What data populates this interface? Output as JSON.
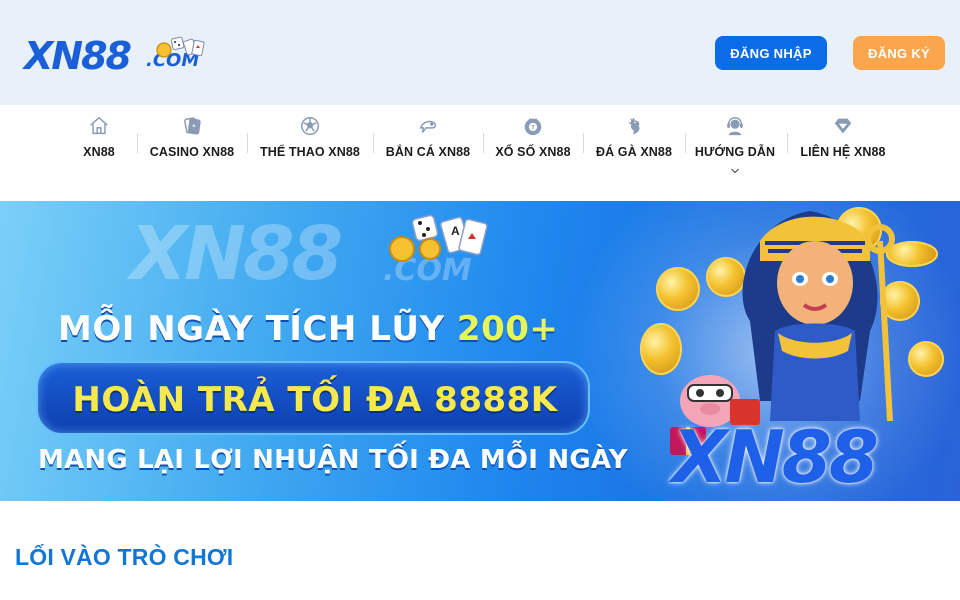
{
  "header": {
    "logo": {
      "main": "XN88",
      "suffix": ".COM"
    },
    "login_label": "ĐĂNG NHẬP",
    "register_label": "ĐĂNG KÝ",
    "colors": {
      "background": "#e8f0fa",
      "login": "#0a6ce6",
      "register": "#f9a64c"
    }
  },
  "nav": {
    "items": [
      {
        "label": "XN88",
        "icon": "home-icon"
      },
      {
        "label": "CASINO XN88",
        "icon": "cards-icon"
      },
      {
        "label": "THỂ THAO XN88",
        "icon": "soccer-ball-icon"
      },
      {
        "label": "BẮN CÁ XN88",
        "icon": "fish-icon"
      },
      {
        "label": "XỔ SỐ XN88",
        "icon": "lottery-ball-icon"
      },
      {
        "label": "ĐÁ GÀ XN88",
        "icon": "rooster-icon"
      },
      {
        "label": "HƯỚNG DẪN",
        "icon": "support-agent-icon",
        "has_dropdown": true
      },
      {
        "label": "LIÊN HỆ XN88",
        "icon": "diamond-icon"
      }
    ]
  },
  "banner": {
    "ghost_logo": "XN88",
    "ghost_logo_suffix": ".COM",
    "line1_prefix": "MỖI NGÀY TÍCH LŨY ",
    "line1_highlight": "200+",
    "line2": "HOÀN TRẢ TỐI ĐA 8888K",
    "line3": "MANG LẠI LỢI NHUẬN TỐI ĐA MỖI NGÀY",
    "brand": "XN88"
  },
  "section": {
    "title": "LỐI VÀO TRÒ CHƠI",
    "color": "#1177d6"
  }
}
